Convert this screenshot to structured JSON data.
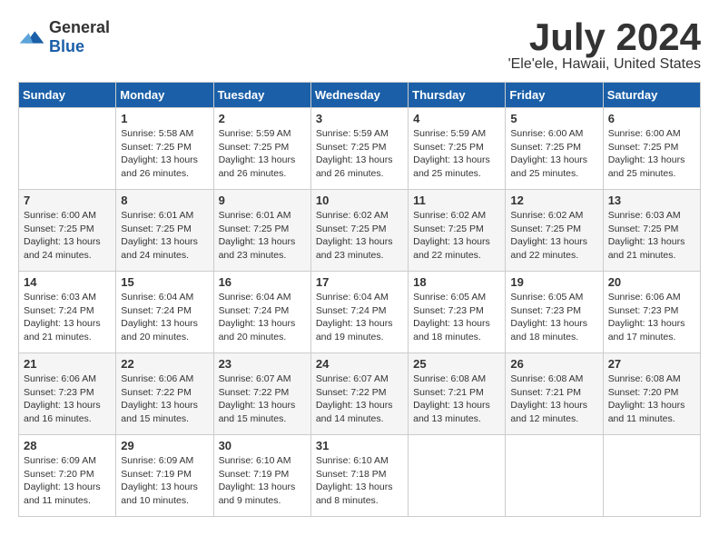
{
  "header": {
    "logo_general": "General",
    "logo_blue": "Blue",
    "month_year": "July 2024",
    "location": "'Ele'ele, Hawaii, United States"
  },
  "days_of_week": [
    "Sunday",
    "Monday",
    "Tuesday",
    "Wednesday",
    "Thursday",
    "Friday",
    "Saturday"
  ],
  "weeks": [
    [
      {
        "day": "",
        "sunrise": "",
        "sunset": "",
        "daylight": ""
      },
      {
        "day": "1",
        "sunrise": "Sunrise: 5:58 AM",
        "sunset": "Sunset: 7:25 PM",
        "daylight": "Daylight: 13 hours and 26 minutes."
      },
      {
        "day": "2",
        "sunrise": "Sunrise: 5:59 AM",
        "sunset": "Sunset: 7:25 PM",
        "daylight": "Daylight: 13 hours and 26 minutes."
      },
      {
        "day": "3",
        "sunrise": "Sunrise: 5:59 AM",
        "sunset": "Sunset: 7:25 PM",
        "daylight": "Daylight: 13 hours and 26 minutes."
      },
      {
        "day": "4",
        "sunrise": "Sunrise: 5:59 AM",
        "sunset": "Sunset: 7:25 PM",
        "daylight": "Daylight: 13 hours and 25 minutes."
      },
      {
        "day": "5",
        "sunrise": "Sunrise: 6:00 AM",
        "sunset": "Sunset: 7:25 PM",
        "daylight": "Daylight: 13 hours and 25 minutes."
      },
      {
        "day": "6",
        "sunrise": "Sunrise: 6:00 AM",
        "sunset": "Sunset: 7:25 PM",
        "daylight": "Daylight: 13 hours and 25 minutes."
      }
    ],
    [
      {
        "day": "7",
        "sunrise": "Sunrise: 6:00 AM",
        "sunset": "Sunset: 7:25 PM",
        "daylight": "Daylight: 13 hours and 24 minutes."
      },
      {
        "day": "8",
        "sunrise": "Sunrise: 6:01 AM",
        "sunset": "Sunset: 7:25 PM",
        "daylight": "Daylight: 13 hours and 24 minutes."
      },
      {
        "day": "9",
        "sunrise": "Sunrise: 6:01 AM",
        "sunset": "Sunset: 7:25 PM",
        "daylight": "Daylight: 13 hours and 23 minutes."
      },
      {
        "day": "10",
        "sunrise": "Sunrise: 6:02 AM",
        "sunset": "Sunset: 7:25 PM",
        "daylight": "Daylight: 13 hours and 23 minutes."
      },
      {
        "day": "11",
        "sunrise": "Sunrise: 6:02 AM",
        "sunset": "Sunset: 7:25 PM",
        "daylight": "Daylight: 13 hours and 22 minutes."
      },
      {
        "day": "12",
        "sunrise": "Sunrise: 6:02 AM",
        "sunset": "Sunset: 7:25 PM",
        "daylight": "Daylight: 13 hours and 22 minutes."
      },
      {
        "day": "13",
        "sunrise": "Sunrise: 6:03 AM",
        "sunset": "Sunset: 7:25 PM",
        "daylight": "Daylight: 13 hours and 21 minutes."
      }
    ],
    [
      {
        "day": "14",
        "sunrise": "Sunrise: 6:03 AM",
        "sunset": "Sunset: 7:24 PM",
        "daylight": "Daylight: 13 hours and 21 minutes."
      },
      {
        "day": "15",
        "sunrise": "Sunrise: 6:04 AM",
        "sunset": "Sunset: 7:24 PM",
        "daylight": "Daylight: 13 hours and 20 minutes."
      },
      {
        "day": "16",
        "sunrise": "Sunrise: 6:04 AM",
        "sunset": "Sunset: 7:24 PM",
        "daylight": "Daylight: 13 hours and 20 minutes."
      },
      {
        "day": "17",
        "sunrise": "Sunrise: 6:04 AM",
        "sunset": "Sunset: 7:24 PM",
        "daylight": "Daylight: 13 hours and 19 minutes."
      },
      {
        "day": "18",
        "sunrise": "Sunrise: 6:05 AM",
        "sunset": "Sunset: 7:23 PM",
        "daylight": "Daylight: 13 hours and 18 minutes."
      },
      {
        "day": "19",
        "sunrise": "Sunrise: 6:05 AM",
        "sunset": "Sunset: 7:23 PM",
        "daylight": "Daylight: 13 hours and 18 minutes."
      },
      {
        "day": "20",
        "sunrise": "Sunrise: 6:06 AM",
        "sunset": "Sunset: 7:23 PM",
        "daylight": "Daylight: 13 hours and 17 minutes."
      }
    ],
    [
      {
        "day": "21",
        "sunrise": "Sunrise: 6:06 AM",
        "sunset": "Sunset: 7:23 PM",
        "daylight": "Daylight: 13 hours and 16 minutes."
      },
      {
        "day": "22",
        "sunrise": "Sunrise: 6:06 AM",
        "sunset": "Sunset: 7:22 PM",
        "daylight": "Daylight: 13 hours and 15 minutes."
      },
      {
        "day": "23",
        "sunrise": "Sunrise: 6:07 AM",
        "sunset": "Sunset: 7:22 PM",
        "daylight": "Daylight: 13 hours and 15 minutes."
      },
      {
        "day": "24",
        "sunrise": "Sunrise: 6:07 AM",
        "sunset": "Sunset: 7:22 PM",
        "daylight": "Daylight: 13 hours and 14 minutes."
      },
      {
        "day": "25",
        "sunrise": "Sunrise: 6:08 AM",
        "sunset": "Sunset: 7:21 PM",
        "daylight": "Daylight: 13 hours and 13 minutes."
      },
      {
        "day": "26",
        "sunrise": "Sunrise: 6:08 AM",
        "sunset": "Sunset: 7:21 PM",
        "daylight": "Daylight: 13 hours and 12 minutes."
      },
      {
        "day": "27",
        "sunrise": "Sunrise: 6:08 AM",
        "sunset": "Sunset: 7:20 PM",
        "daylight": "Daylight: 13 hours and 11 minutes."
      }
    ],
    [
      {
        "day": "28",
        "sunrise": "Sunrise: 6:09 AM",
        "sunset": "Sunset: 7:20 PM",
        "daylight": "Daylight: 13 hours and 11 minutes."
      },
      {
        "day": "29",
        "sunrise": "Sunrise: 6:09 AM",
        "sunset": "Sunset: 7:19 PM",
        "daylight": "Daylight: 13 hours and 10 minutes."
      },
      {
        "day": "30",
        "sunrise": "Sunrise: 6:10 AM",
        "sunset": "Sunset: 7:19 PM",
        "daylight": "Daylight: 13 hours and 9 minutes."
      },
      {
        "day": "31",
        "sunrise": "Sunrise: 6:10 AM",
        "sunset": "Sunset: 7:18 PM",
        "daylight": "Daylight: 13 hours and 8 minutes."
      },
      {
        "day": "",
        "sunrise": "",
        "sunset": "",
        "daylight": ""
      },
      {
        "day": "",
        "sunrise": "",
        "sunset": "",
        "daylight": ""
      },
      {
        "day": "",
        "sunrise": "",
        "sunset": "",
        "daylight": ""
      }
    ]
  ]
}
